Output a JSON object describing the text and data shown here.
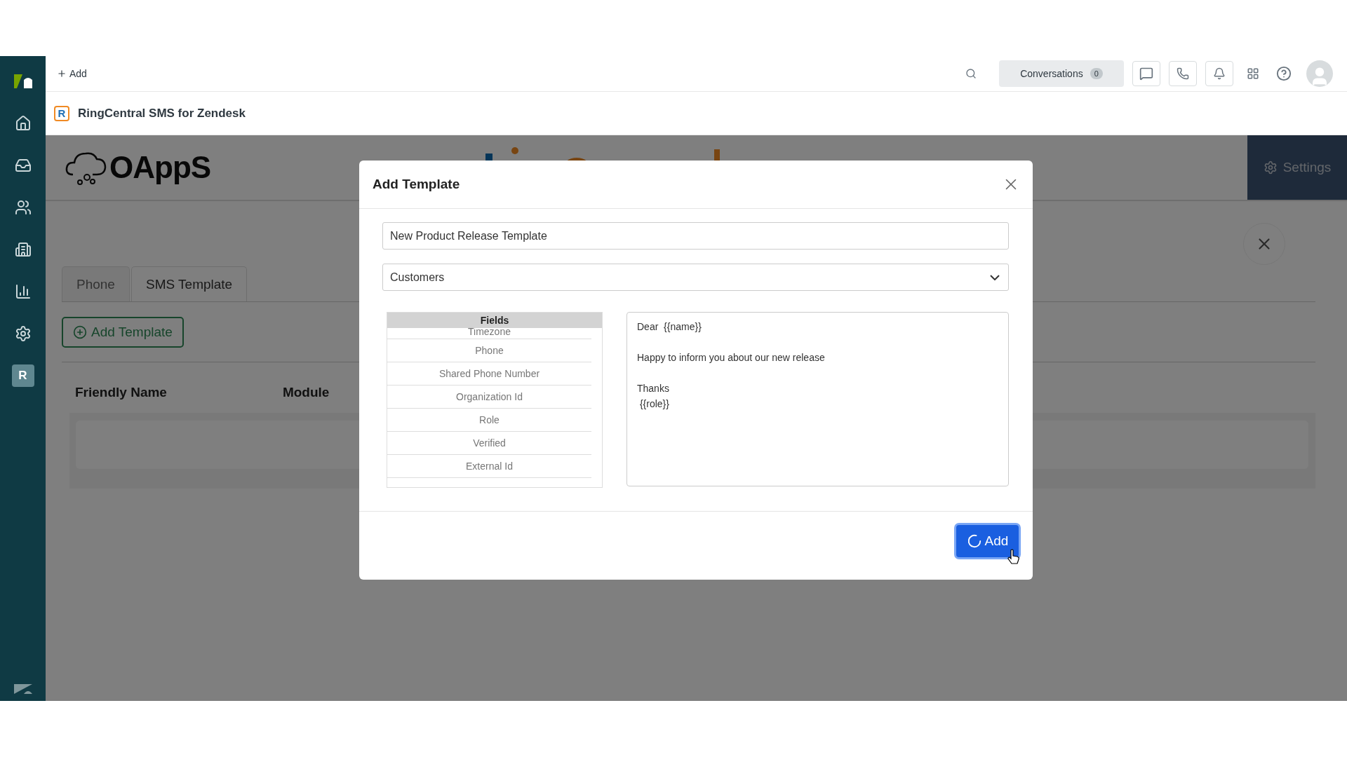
{
  "sidebar": {
    "items": [
      {
        "selected": false
      },
      {
        "selected": false
      },
      {
        "selected": false
      },
      {
        "selected": false
      },
      {
        "selected": false
      },
      {
        "selected": false
      },
      {
        "selected": true,
        "label": "R"
      }
    ]
  },
  "top_bar": {
    "add_button": "Add",
    "conversations": {
      "label": "Conversations",
      "count": "0"
    }
  },
  "app_header": {
    "icon_letter": "R",
    "title": "RingCentral SMS for Zendesk"
  },
  "content": {
    "logo_text": "OAppS",
    "settings_button": "Settings",
    "tabs": [
      {
        "label": "Phone",
        "selected": false
      },
      {
        "label": "SMS Template",
        "selected": true
      }
    ],
    "add_template_button": "Add Template",
    "table": {
      "columns": [
        "Friendly Name",
        "Module"
      ]
    }
  },
  "modal": {
    "title": "Add Template",
    "name_value": "New Product Release Template",
    "module_value": "Customers",
    "fields_header": "Fields",
    "fields": [
      "Timezone",
      "Phone",
      "Shared Phone Number",
      "Organization Id",
      "Role",
      "Verified",
      "External Id"
    ],
    "message": "Dear  {{name}}\n\nHappy to inform you about our new release\n\nThanks\n {{role}}",
    "submit": {
      "label": "Add",
      "loading": true
    }
  }
}
